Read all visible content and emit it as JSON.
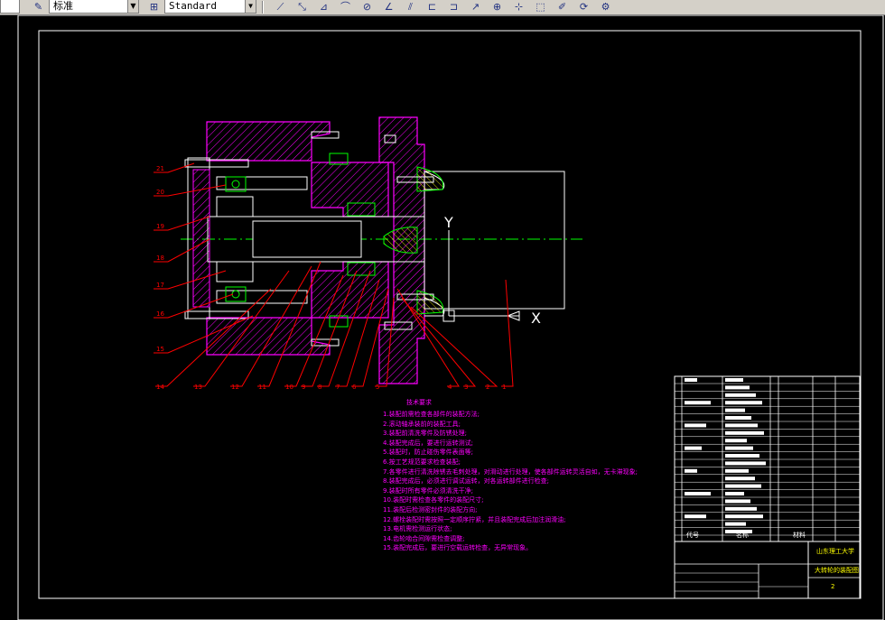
{
  "toolbar": {
    "style_combo_value": "标准",
    "dim_style_combo_value": "Standard",
    "icons": [
      "dim-linear-icon",
      "dim-aligned-icon",
      "dim-ordinate-icon",
      "dim-radius-icon",
      "dim-diameter-icon",
      "dim-angular-icon",
      "quick-dim-icon",
      "baseline-icon",
      "continue-icon",
      "leader-icon",
      "tolerance-icon",
      "center-mark-icon",
      "dim-edit-icon",
      "dim-text-edit-icon",
      "dim-update-icon",
      "dim-style-icon"
    ]
  },
  "drawing": {
    "axis_y_label": "Y",
    "axis_x_label": "X",
    "part_numbers_left": [
      "21",
      "20",
      "19",
      "18",
      "17",
      "16",
      "15"
    ],
    "part_numbers_bottom": [
      "14",
      "13",
      "12",
      "11",
      "10",
      "9",
      "8",
      "7",
      "6",
      "5",
      "4",
      "3",
      "2",
      "1"
    ],
    "notes_title": "技术要求",
    "notes": [
      "1.装配前需检查各部件的装配方法;",
      "2.滚动轴承装前的装配工具;",
      "3.装配前清洗零件及防锈处理;",
      "4.装配完成后，要进行运转测试;",
      "5.装配时，防止碰伤零件表面等;",
      "6.按工艺规范要求检查装配;",
      "7.各零件进行清洗除锈去毛刺处理，对滑动进行处理，使各部件运转灵活自如，无卡滞现象;",
      "8.装配完成后，必须进行调试运转，对各运转部件进行检查;",
      "9.装配时所有零件必须清洗干净;",
      "10.装配时需检查各零件的装配尺寸;",
      "11.装配后检测密封件的装配方向;",
      "12.螺栓装配时需按照一定顺序拧紧，并且装配完成后加注润滑油;",
      "13.电机需检测运行状态;",
      "14.齿轮啮合间隙需检查调整;",
      "15.装配完成后，要进行空载运转检查，无异常现象。"
    ],
    "title_block": {
      "school": "山东理工大学",
      "drawing_name": "大转轮的装配图",
      "sheet": "2",
      "headers": [
        "代号",
        "名称",
        "材料"
      ]
    }
  },
  "colors": {
    "background": "#000000",
    "frame": "#ffffff",
    "section": "#ff00ff",
    "leader": "#ff0000",
    "center": "#00ff00",
    "bearing": "#00ff00",
    "text_magenta": "#ff00ff"
  }
}
